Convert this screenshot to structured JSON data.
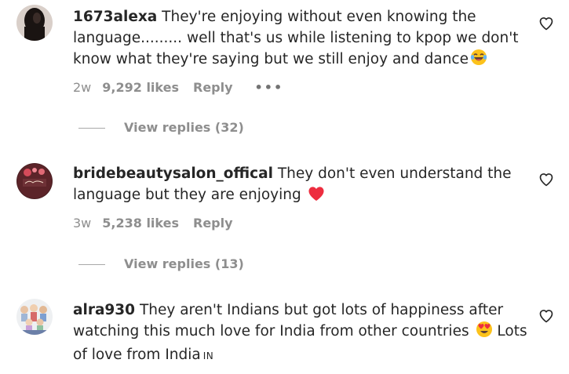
{
  "comments": [
    {
      "username": "1673alexa",
      "text": "They're enjoying without even knowing the language......... well that's us while listening to kpop we don't know what they're saying but we still enjoy and dance",
      "emoji": "laughing-tears",
      "time": "2w",
      "likes": "9,292 likes",
      "reply": "Reply",
      "more": "•••",
      "view_replies": "View replies (32)"
    },
    {
      "username": "bridebeautysalon_offical",
      "text": "They don't even understand the language but they are enjoying",
      "emoji": "red-heart",
      "time": "3w",
      "likes": "5,238 likes",
      "reply": "Reply",
      "view_replies": "View replies (13)"
    },
    {
      "username": "alra930",
      "text_part1": "They aren't Indians but got lots of happiness after watching this much love for India from other countries",
      "emoji": "heart-eyes",
      "text_part2": "Lots of love from India",
      "flag": "IN"
    }
  ],
  "colors": {
    "text": "#262626",
    "meta": "#8e8e8e",
    "heart": "#ed2d3f"
  }
}
